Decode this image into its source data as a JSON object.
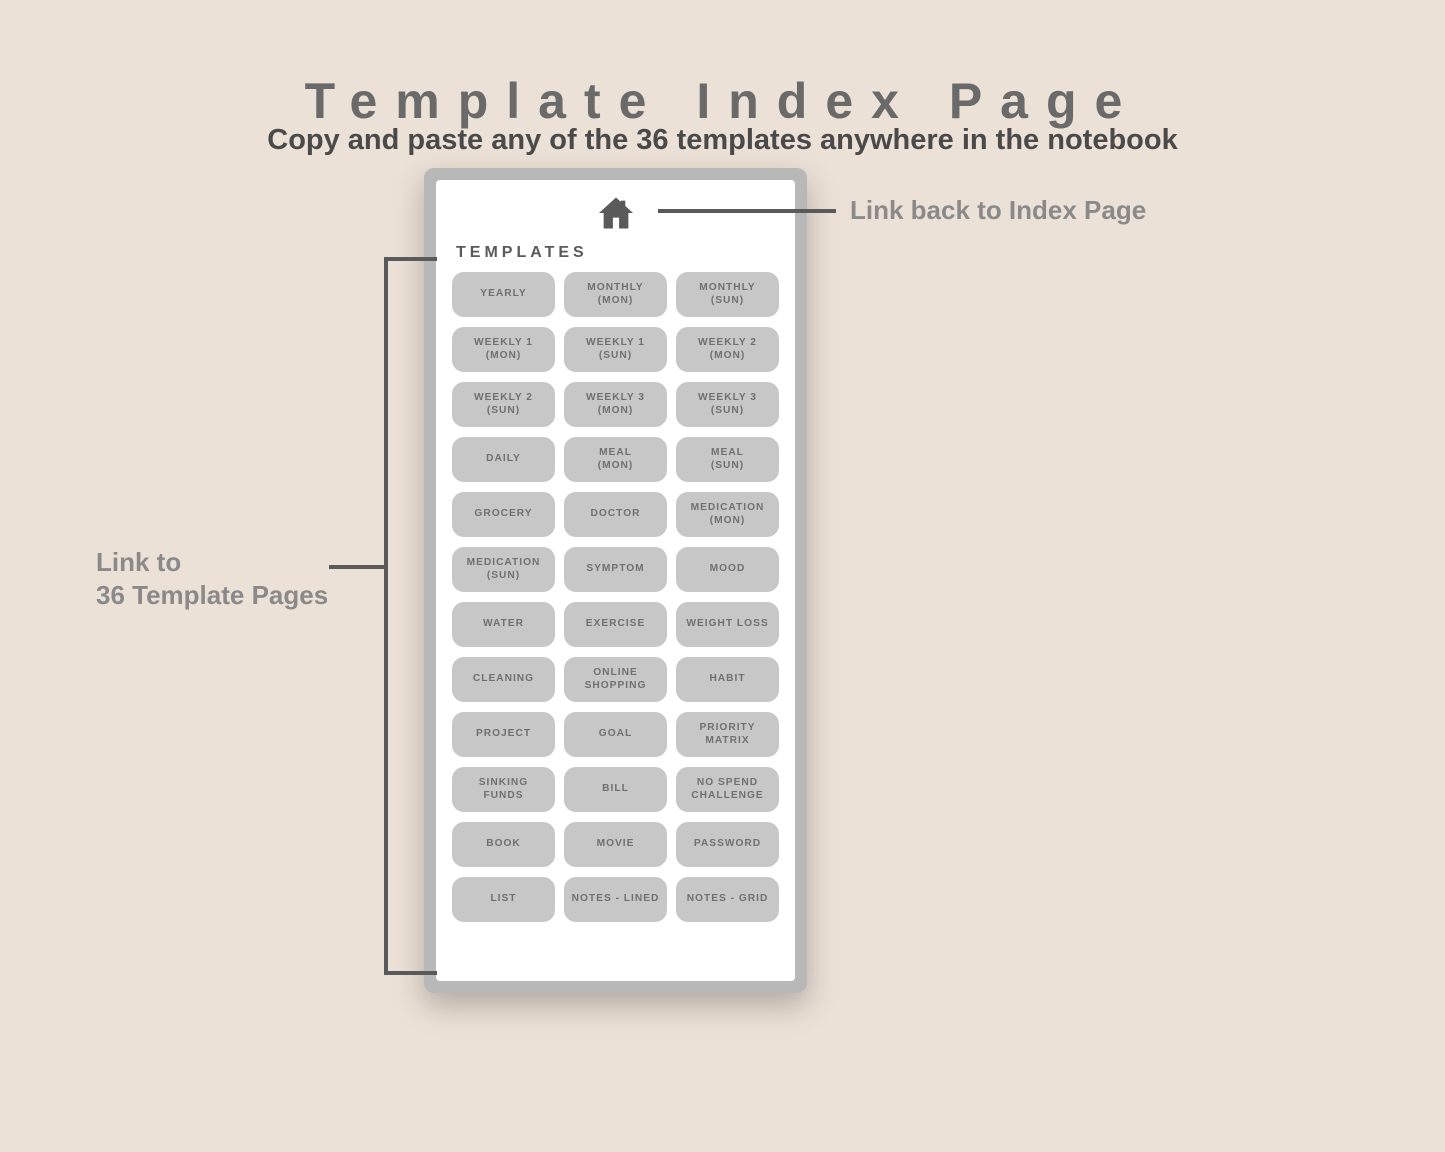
{
  "title": "Template Index Page",
  "subtitle": "Copy and paste any of the 36 templates anywhere in the notebook",
  "screen_heading": "TEMPLATES",
  "annotations": {
    "index_link": "Link back to Index Page",
    "template_links": "Link to\n36 Template Pages"
  },
  "templates": [
    "YEARLY",
    "MONTHLY\n(MON)",
    "MONTHLY\n(SUN)",
    "WEEKLY 1\n(MON)",
    "WEEKLY 1\n(SUN)",
    "WEEKLY 2\n(MON)",
    "WEEKLY 2\n(SUN)",
    "WEEKLY 3\n(MON)",
    "WEEKLY 3\n(SUN)",
    "DAILY",
    "MEAL\n(MON)",
    "MEAL\n(SUN)",
    "GROCERY",
    "DOCTOR",
    "MEDICATION\n(MON)",
    "MEDICATION\n(SUN)",
    "SYMPTOM",
    "MOOD",
    "WATER",
    "EXERCISE",
    "WEIGHT LOSS",
    "CLEANING",
    "ONLINE\nSHOPPING",
    "HABIT",
    "PROJECT",
    "GOAL",
    "PRIORITY\nMATRIX",
    "SINKING\nFUNDS",
    "BILL",
    "NO SPEND\nCHALLENGE",
    "BOOK",
    "MOVIE",
    "PASSWORD",
    "LIST",
    "NOTES - LINED",
    "NOTES - GRID"
  ]
}
